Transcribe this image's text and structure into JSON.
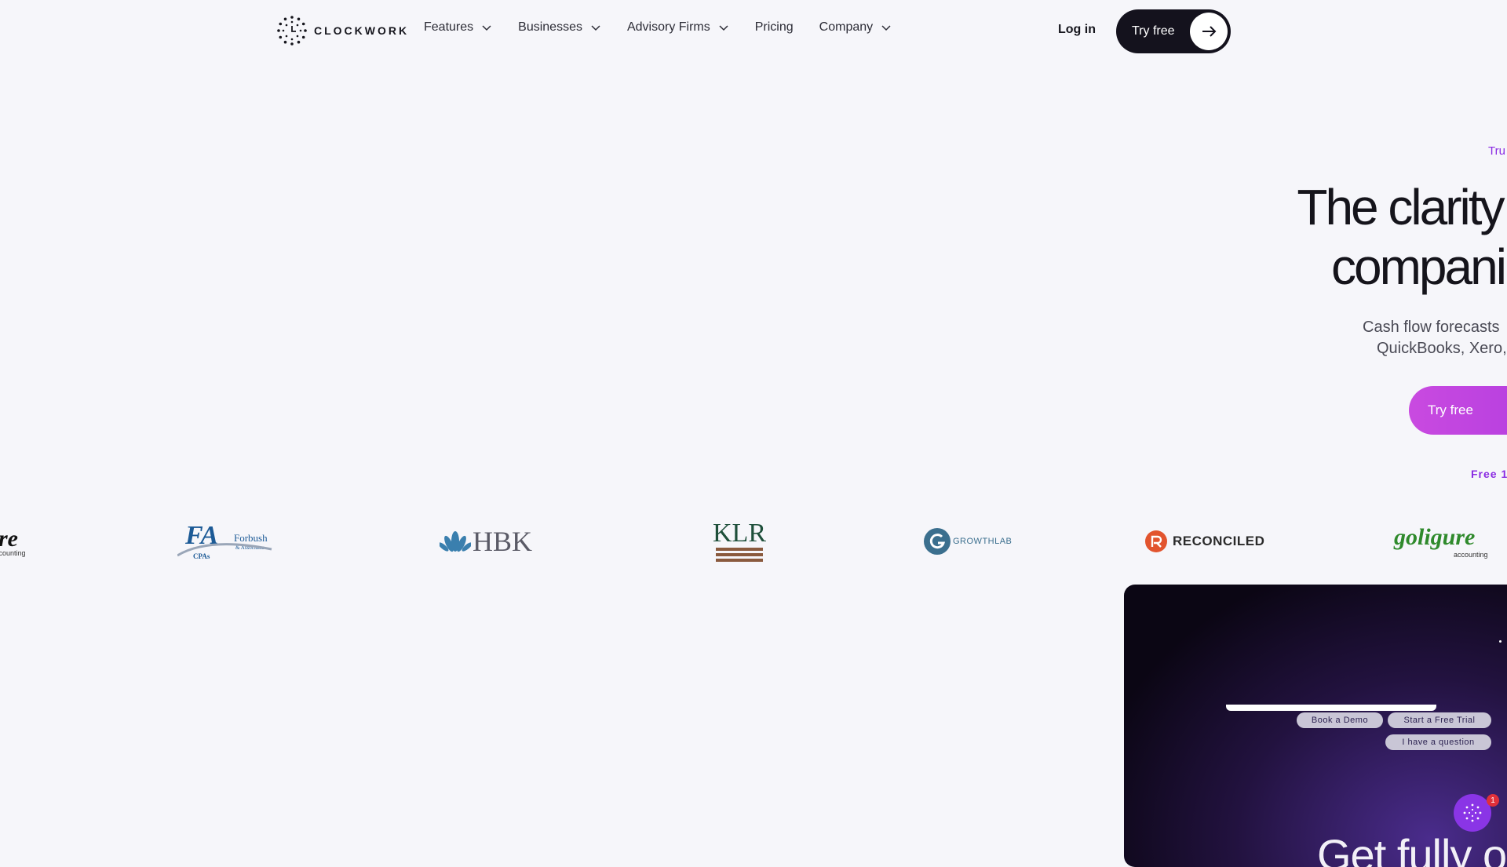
{
  "nav": {
    "brand": "CLOCKWORK",
    "items": [
      {
        "label": "Features"
      },
      {
        "label": "Businesses"
      },
      {
        "label": "Advisory Firms"
      },
      {
        "label": "Pricing"
      },
      {
        "label": "Company"
      }
    ],
    "login": "Log in",
    "try_free": "Try free"
  },
  "hero": {
    "tag": "Tru",
    "title_line1": "The clarity",
    "title_line2": "compani",
    "subtitle_line1": "Cash flow forecasts",
    "subtitle_line2": "QuickBooks, Xero,",
    "cta": "Try free",
    "note": "Free 1"
  },
  "logo_strip": {
    "partial_left": "re",
    "partial_left_sub": "ccounting",
    "forbush_main": "FA",
    "forbush_name": "Forbush",
    "forbush_sub": "& Associates",
    "forbush_cpas": "CPAs",
    "hbk": "HBK",
    "klr": "KLR",
    "growthlab": "GROWTHLAB",
    "reconciled": "RECONCILED",
    "goligure": "goligure",
    "goligure_sub": "accounting"
  },
  "panel": {
    "chips": [
      "Book a Demo",
      "Start a Free Trial",
      "I have a question"
    ],
    "big_text": "Get fully o"
  },
  "chat": {
    "badge": "1"
  },
  "colors": {
    "accent": "#8a2be2",
    "dark": "#14121d",
    "cta_gradient": "#c94ae0"
  }
}
